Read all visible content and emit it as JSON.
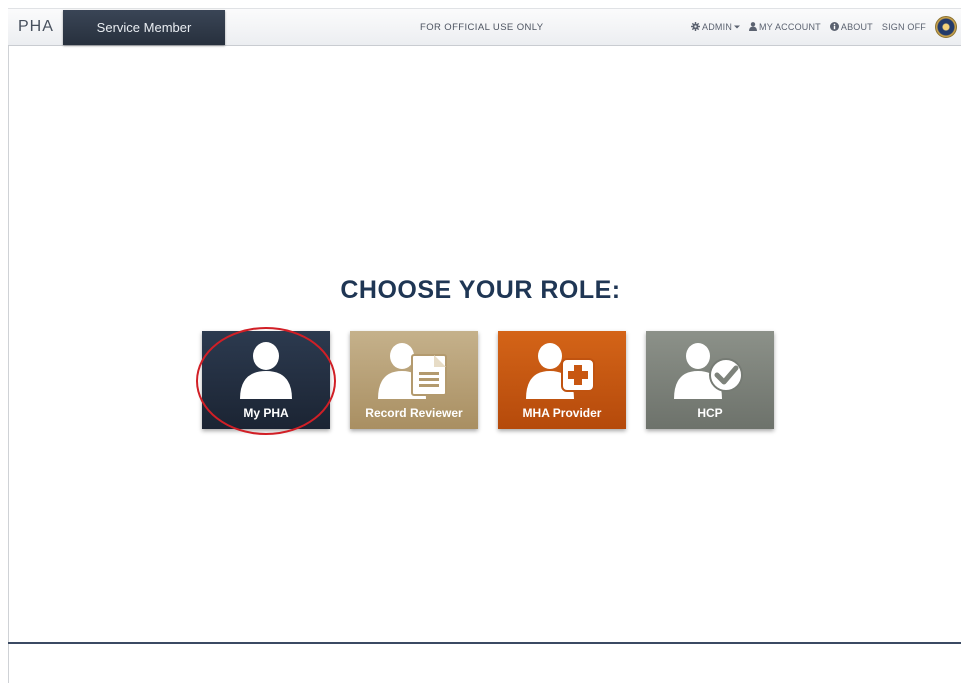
{
  "header": {
    "brand": "PHA",
    "role_tab": "Service Member",
    "notice": "FOR OFFICIAL USE ONLY",
    "nav": {
      "admin": "ADMIN",
      "my_account": "MY ACCOUNT",
      "about": "ABOUT",
      "sign_off": "SIGN OFF"
    },
    "icons": [
      "gear-icon",
      "chevron-down-icon",
      "user-icon",
      "info-icon",
      "seal-icon"
    ]
  },
  "main": {
    "title": "CHOOSE YOUR ROLE:",
    "tiles": [
      {
        "label": "My PHA",
        "icon": "user-icon",
        "color": "#243044"
      },
      {
        "label": "Record Reviewer",
        "icon": "user-document-icon",
        "color": "#b8a176"
      },
      {
        "label": "MHA Provider",
        "icon": "user-plus-icon",
        "color": "#c85711"
      },
      {
        "label": "HCP",
        "icon": "user-check-icon",
        "color": "#7d827b"
      }
    ],
    "highlight_color": "#d11f26"
  }
}
